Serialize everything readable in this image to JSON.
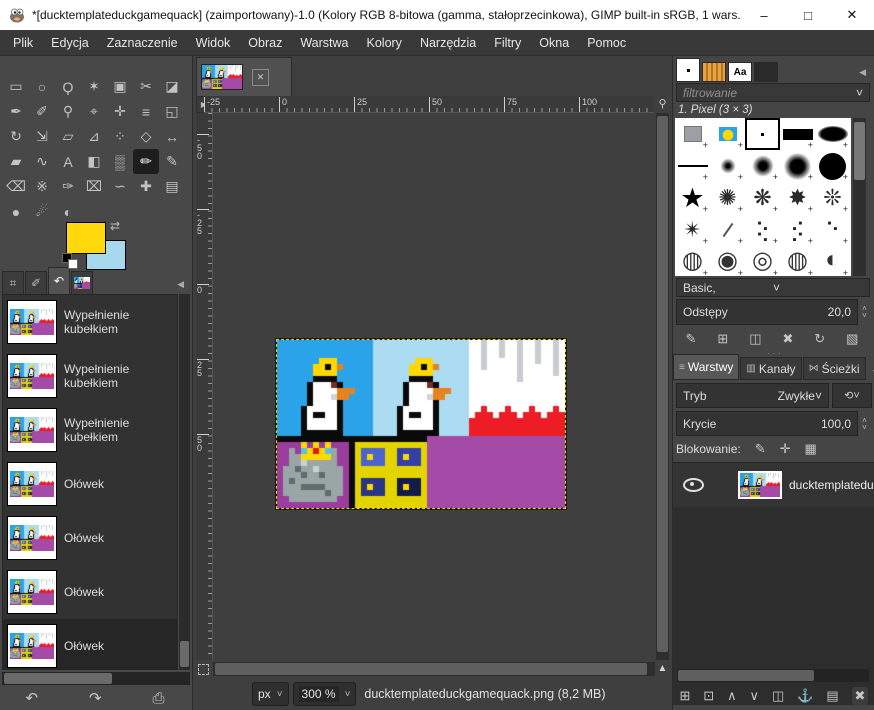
{
  "window": {
    "title": "*[ducktemplateduckgamequack] (zaimportowany)-1.0 (Kolory RGB 8-bitowa (gamma, stałoprzecinkowa), GIMP built-in sRGB, 1 wars...",
    "minimize": "–",
    "maximize": "□",
    "close": "✕"
  },
  "menu": {
    "items": [
      "Plik",
      "Edycja",
      "Zaznaczenie",
      "Widok",
      "Obraz",
      "Warstwa",
      "Kolory",
      "Narzędzia",
      "Filtry",
      "Okna",
      "Pomoc"
    ]
  },
  "toolbox": {
    "selected_index": 26,
    "tools": [
      {
        "name": "rectangle-select",
        "glyph": "▭"
      },
      {
        "name": "ellipse-select",
        "glyph": "○"
      },
      {
        "name": "free-select",
        "glyph": "Ϙ"
      },
      {
        "name": "fuzzy-select",
        "glyph": "✶"
      },
      {
        "name": "select-by-color",
        "glyph": "▣"
      },
      {
        "name": "scissors-select",
        "glyph": "✂"
      },
      {
        "name": "foreground-select",
        "glyph": "◪"
      },
      {
        "name": "paths",
        "glyph": "✒"
      },
      {
        "name": "color-picker",
        "glyph": "✐"
      },
      {
        "name": "zoom",
        "glyph": "⚲"
      },
      {
        "name": "measure",
        "glyph": "⌖"
      },
      {
        "name": "move",
        "glyph": "✛"
      },
      {
        "name": "align",
        "glyph": "≡"
      },
      {
        "name": "crop",
        "glyph": "◱"
      },
      {
        "name": "rotate",
        "glyph": "↻"
      },
      {
        "name": "scale",
        "glyph": "⇲"
      },
      {
        "name": "shear",
        "glyph": "▱"
      },
      {
        "name": "perspective",
        "glyph": "⊿"
      },
      {
        "name": "unified-transform",
        "glyph": "⁘"
      },
      {
        "name": "transform-3d",
        "glyph": "◇"
      },
      {
        "name": "flip",
        "glyph": "↔"
      },
      {
        "name": "cage-transform",
        "glyph": "▰"
      },
      {
        "name": "warp-transform",
        "glyph": "∿"
      },
      {
        "name": "text",
        "glyph": "A"
      },
      {
        "name": "bucket-fill",
        "glyph": "◧"
      },
      {
        "name": "gradient",
        "glyph": "▒"
      },
      {
        "name": "pencil",
        "glyph": "✏"
      },
      {
        "name": "paintbrush",
        "glyph": "✎"
      },
      {
        "name": "eraser",
        "glyph": "⌫"
      },
      {
        "name": "airbrush",
        "glyph": "※"
      },
      {
        "name": "ink",
        "glyph": "✑"
      },
      {
        "name": "clone",
        "glyph": "⌧"
      },
      {
        "name": "smudge-tool",
        "glyph": "∽"
      },
      {
        "name": "heal",
        "glyph": "✚"
      },
      {
        "name": "perspective-clone",
        "glyph": "▤"
      },
      {
        "name": "blur-sharpen",
        "glyph": "●"
      },
      {
        "name": "smudge",
        "glyph": "☄"
      },
      {
        "name": "dodge-burn",
        "glyph": "◐"
      }
    ]
  },
  "color_selector": {
    "foreground": "#ffd90b",
    "background": "#a7d9ee",
    "swap_glyph": "⇄"
  },
  "left_tabs": {
    "tabs": [
      {
        "name": "tab-tool-options",
        "glyph": "⌗",
        "active": false
      },
      {
        "name": "tab-device-status",
        "glyph": "✐",
        "active": false
      },
      {
        "name": "tab-undo-history",
        "glyph": "↶",
        "active": true
      },
      {
        "name": "tab-images",
        "glyph": "",
        "active": false,
        "thumb": true
      }
    ],
    "collapse_glyph": "◀"
  },
  "history": {
    "items": [
      {
        "label": "Wypełnienie kubełkiem"
      },
      {
        "label": "Wypełnienie kubełkiem"
      },
      {
        "label": "Wypełnienie kubełkiem"
      },
      {
        "label": "Ołówek"
      },
      {
        "label": "Ołówek"
      },
      {
        "label": "Ołówek"
      },
      {
        "label": "Ołówek"
      }
    ],
    "selected_index": 6,
    "actions": [
      {
        "name": "undo-button",
        "glyph": "↶"
      },
      {
        "name": "redo-button",
        "glyph": "↷"
      },
      {
        "name": "clear-history-button",
        "glyph": "⎙"
      }
    ]
  },
  "canvas": {
    "tab_close": "✕",
    "corner_glyph": "▶",
    "magnifier_glyph": "⚲",
    "nav_glyph": "▲",
    "h_ruler_labels": [
      "-25",
      "0",
      "25",
      "50",
      "75",
      "100"
    ],
    "v_ruler_labels": [
      "-50",
      "-25",
      "0",
      "25",
      "50"
    ],
    "unit": "px",
    "zoom": "300 %",
    "chevron": "˅",
    "status_text": "ducktemplateduckgamequack.png (8,2 MB)"
  },
  "pixel_art": {
    "palette": {
      "B": "#2aa3e8",
      "L": "#abdcf2",
      "W": "#ffffff",
      "g": "#c9cdd1",
      "R": "#ee1c24",
      "P": "#9a3d9d",
      "M": "#a44aa7",
      "K": "#0a0a0a",
      "Y": "#ffd800",
      "O": "#e5831f",
      "E": "#7b2b2b",
      "h": "#d4d4d4",
      "s": "#9aa5a5",
      "d": "#5f6c6c",
      "t": "#c9d2d2",
      "r": "#e01818",
      "c": "#4fc3e8",
      "1": "#4c62cc",
      "2": "#3340a9",
      "3": "#2a3584",
      "4": "#131b4b",
      "y": "#e3d400"
    },
    "rows": [
      "BBBBBBBBBBBBBBBBLLLLLLLLLLLLLLLLWWgWWgWWgWWgWWgW",
      "BBBBBBBBBBBBBBBBLLLLLLLLLLLLLLLLWWgWWgWWgWWgWWgW",
      "BBBBBBBBBBBBBBBBLLLLLLLLLLLLLLLLWWgWWgWWgWWgWWgW",
      "BBBBBBBYYYBBBBBBLLLLLLLYYYLLLLLLWWgWWWWWgWWgWWgW",
      "BBBBBBYYKYOBBBBBLLLLLLYYKYOLLLLLWWgWWWWWgWWWWWgW",
      "BBBBBBYYYYBBBBBBLLLLLLYYYYLLLLLLWWWWWWWWgWWWWWgW",
      "BBBBBBKKKKBBBBBBLLLLLLKKKKLLLLLLWWWWWWWWgWWWWWWW",
      "BBBBBKWWWEKBBBBBLLLLLKWWWEKLLLLLWWWWWWWWWWWWWWWW",
      "BBBBBKWWWWOOOBBBLLLLLKWWWWOOOLLLWWWWWWWWWWWWWWWW",
      "BBBBBKWWWhOOBBBBLLLLLKWWWhOOLLLLWWWWWWWWWWWWWWWW",
      "BBBBBKWWWWKBBBBBLLLLLKWWWWKLLLLLWWWWWWWWWWWWWWWW",
      "BBBBKWWWWWKBBBBBLLLLKWWWWWKLLLLLWWRWWWRWWWRWWWRW",
      "BBBBKWKKWWKBBBBBLLLLKWKKWWKLLLLLWRRRWRRRWRRRWRRR",
      "BBBBKWWWWWKBBBBBLLLLKWWWWWKLLLLLRRRRRRRRRRRRRRRR",
      "BBBBKWWWWWKBBBBBLLLLKWWWWWKLLLLLRRRRRRRRRRRRRRRR",
      "BBBBKKKKKKKBBBBBLLLLKKKKKKKLLLLLRRRRRRRRRRRRRRRR",
      "KKKKKKKKKKKKKKKKKKKKKKKKKMMMMMMMMMMMMMMMMMMMMMMM",
      "PPPPYPYPYPPPKyyyyyyyyyyyyMMMMMMMMMMMMMMMMMMMMMMM",
      "PPsPcYrYcsPPKy1111yy2222yMMMMMMMMMMMMMMMMMMMMMMM",
      "PPssYYYYYsPPKy1Y11yy2Y22yMMMMMMMMMMMMMMMMMMMMMMM",
      "PPsstsssssPPKy1111yy2222yMMMMMMMMMMMMMMMMMMMMMMM",
      "PssdsstssssPKyyyyyyyyyyyyMMMMMMMMMMMMMMMMMMMMMMM",
      "PsssdssdsssPKyyyyyyyyyyyyMMMMMMMMMMMMMMMMMMMMMMM",
      "PsdssssssssPKy3333yy4444yMMMMMMMMMMMMMMMMMMMMMMM",
      "PsssddddsssPKy3Y33yy4Y44yMMMMMMMMMMMMMMMMMMMMMMM",
      "PsssssssdssPKy3333yy4444yMMMMMMMMMMMMMMMMMMMMMMM",
      "PPssssssssPPKyyyyyyyyyyyyMMMMMMMMMMMMMMMMMMMMMMM",
      "PPPPPPPPPPPPKyyyyyyyyyyyyMMMMMMMMMMMMMMMMMMMMMMM"
    ]
  },
  "brushes_panel": {
    "tabs": [
      {
        "name": "tab-brushes",
        "kind": "brush",
        "active": true
      },
      {
        "name": "tab-patterns",
        "kind": "pattern",
        "active": false
      },
      {
        "name": "tab-fonts",
        "kind": "font",
        "label": "Aa",
        "active": false
      },
      {
        "name": "tab-document-history",
        "kind": "image",
        "active": false
      }
    ],
    "collapse_glyph": "◀",
    "filter_placeholder": "filtrowanie",
    "selected_brush_label": "1. Pixel (3 × 3)",
    "group_label": "Basic,",
    "spacing_label": "Odstępy",
    "spacing_value": "20,0",
    "brushes": [
      {
        "name": "clipboard-brush",
        "kind": "clipboard",
        "glyph": ""
      },
      {
        "name": "duck-image-brush",
        "kind": "duckimg",
        "glyph": ""
      },
      {
        "name": "pixel-brush",
        "kind": "pixel",
        "glyph": "",
        "selected": true
      },
      {
        "name": "block-brush",
        "kind": "bar",
        "glyph": ""
      },
      {
        "name": "soft-ellipse-brush",
        "kind": "ellipse",
        "glyph": ""
      },
      {
        "name": "line-brush",
        "kind": "line",
        "glyph": ""
      },
      {
        "name": "fuzzy-small-brush",
        "kind": "fuzz1",
        "glyph": ""
      },
      {
        "name": "fuzzy-medium-brush",
        "kind": "fuzz2",
        "glyph": ""
      },
      {
        "name": "fuzzy-large-brush",
        "kind": "fuzz3",
        "glyph": ""
      },
      {
        "name": "round-brush",
        "kind": "circle",
        "glyph": ""
      },
      {
        "name": "star-brush",
        "kind": "star",
        "glyph": "★"
      },
      {
        "name": "chalk-brush",
        "kind": "splat",
        "glyph": "✺"
      },
      {
        "name": "acrylic-brush",
        "kind": "splat",
        "glyph": "❋"
      },
      {
        "name": "splatter-brush",
        "kind": "splat",
        "glyph": "✸"
      },
      {
        "name": "spray-brush",
        "kind": "splat",
        "glyph": "❊"
      },
      {
        "name": "smoke-brush",
        "kind": "splat",
        "glyph": "✴"
      },
      {
        "name": "stroke-brush",
        "kind": "stroke",
        "glyph": ""
      },
      {
        "name": "dots-brush",
        "kind": "dots",
        "glyph": "⢕"
      },
      {
        "name": "scatter-dots-brush",
        "kind": "dots",
        "glyph": "⡪"
      },
      {
        "name": "sparse-dots-brush",
        "kind": "dots",
        "glyph": "⠑"
      },
      {
        "name": "vine-brush",
        "kind": "sphere",
        "glyph": "◍"
      },
      {
        "name": "cell-brush",
        "kind": "sphere",
        "glyph": "◉"
      },
      {
        "name": "sphere-brush",
        "kind": "sphere",
        "glyph": "◎"
      },
      {
        "name": "texture-sphere-brush",
        "kind": "sphere",
        "glyph": "◍"
      },
      {
        "name": "half-sphere-brush",
        "kind": "sphere",
        "glyph": "◐"
      }
    ],
    "actions": [
      {
        "name": "edit-brush-button",
        "glyph": "✎"
      },
      {
        "name": "new-brush-button",
        "glyph": "⊞"
      },
      {
        "name": "duplicate-brush-button",
        "glyph": "◫"
      },
      {
        "name": "delete-brush-button",
        "glyph": "✖"
      },
      {
        "name": "refresh-brushes-button",
        "glyph": "↻"
      },
      {
        "name": "open-brush-as-image-button",
        "glyph": "▧"
      }
    ]
  },
  "layers_panel": {
    "tabs": [
      {
        "name": "tab-layers",
        "label": "Warstwy",
        "glyph": "≡",
        "active": true
      },
      {
        "name": "tab-channels",
        "label": "Kanały",
        "glyph": "▥",
        "active": false
      },
      {
        "name": "tab-paths",
        "label": "Ścieżki",
        "glyph": "⋈",
        "active": false
      }
    ],
    "collapse_glyph": "◀",
    "mode_label": "Tryb",
    "mode_value": "Zwykłe",
    "reset_glyph": "⟲",
    "opacity_label": "Krycie",
    "opacity_value": "100,0",
    "lock_label": "Blokowanie:",
    "lock_icons": [
      {
        "name": "lock-pixels-icon",
        "glyph": "✎"
      },
      {
        "name": "lock-position-icon",
        "glyph": "✛"
      },
      {
        "name": "lock-alpha-icon",
        "glyph": "▦"
      }
    ],
    "layers": [
      {
        "name": "ducktemplateduc",
        "visible": true
      }
    ],
    "actions": [
      {
        "name": "new-layer-button",
        "glyph": "⊞"
      },
      {
        "name": "new-layer-group-button",
        "glyph": "⊡"
      },
      {
        "name": "raise-layer-button",
        "glyph": "∧"
      },
      {
        "name": "lower-layer-button",
        "glyph": "∨"
      },
      {
        "name": "duplicate-layer-button",
        "glyph": "◫"
      },
      {
        "name": "anchor-layer-button",
        "glyph": "⚓"
      },
      {
        "name": "merge-layer-button",
        "glyph": "▤"
      },
      {
        "name": "delete-layer-button",
        "glyph": "✖"
      }
    ]
  }
}
